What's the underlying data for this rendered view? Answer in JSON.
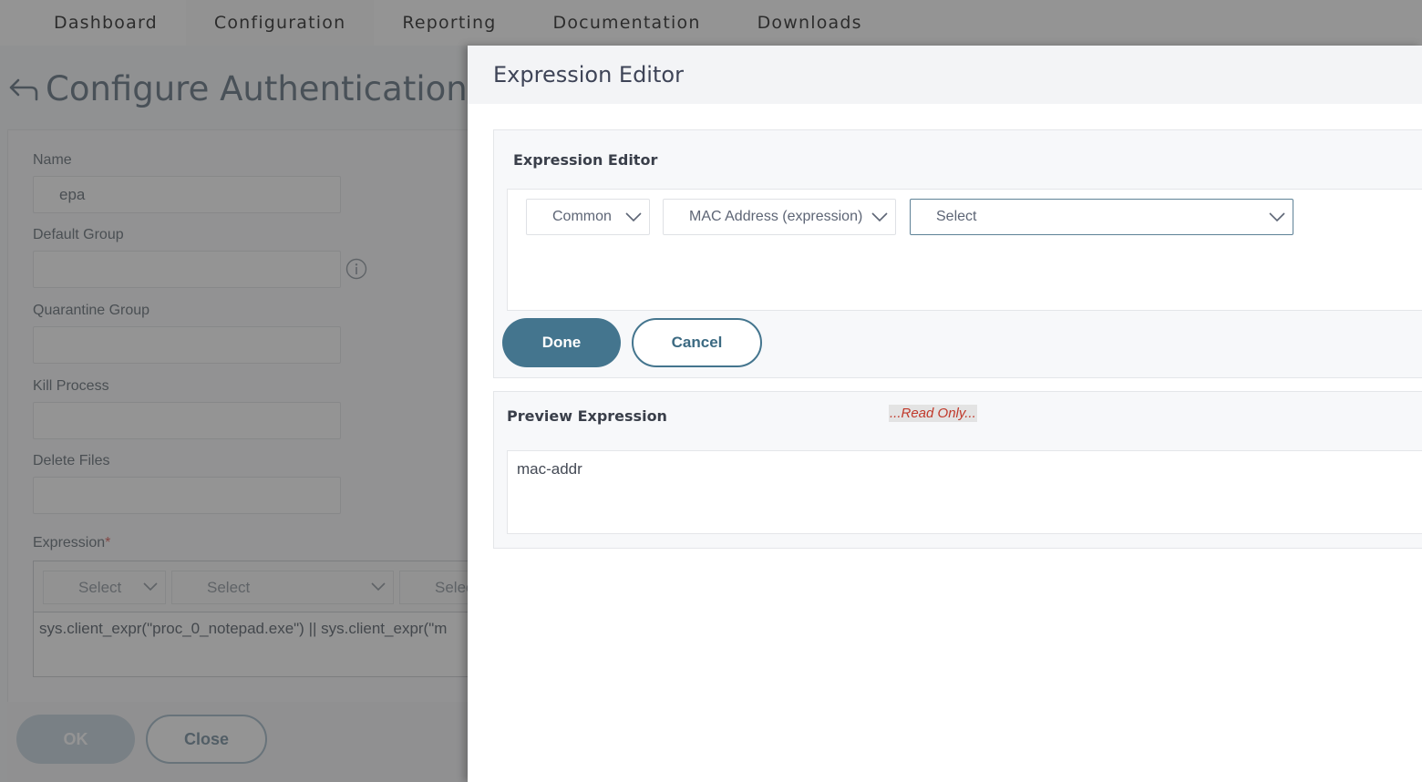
{
  "nav": {
    "tabs": [
      {
        "label": "Dashboard",
        "active": false
      },
      {
        "label": "Configuration",
        "active": true
      },
      {
        "label": "Reporting",
        "active": false
      },
      {
        "label": "Documentation",
        "active": false
      },
      {
        "label": "Downloads",
        "active": false
      }
    ]
  },
  "background_page": {
    "title": "Configure Authentication EPA Action",
    "fields": {
      "name": {
        "label": "Name",
        "value": "epa"
      },
      "default_group": {
        "label": "Default Group",
        "value": ""
      },
      "quarantine_group": {
        "label": "Quarantine Group",
        "value": ""
      },
      "kill_process": {
        "label": "Kill Process",
        "value": ""
      },
      "delete_files": {
        "label": "Delete Files",
        "value": ""
      }
    },
    "expression": {
      "label": "Expression",
      "required_marker": "*",
      "selects": [
        "Select",
        "Select",
        "Select"
      ],
      "value": "sys.client_expr(\"proc_0_notepad.exe\") || sys.client_expr(\"m"
    },
    "buttons": {
      "ok": "OK",
      "close": "Close"
    }
  },
  "drawer": {
    "title": "Expression Editor",
    "editor": {
      "section_title": "Expression Editor",
      "dropdowns": [
        {
          "value": "Common"
        },
        {
          "value": "MAC Address (expression)"
        },
        {
          "value": "Select"
        }
      ],
      "buttons": {
        "done": "Done",
        "cancel": "Cancel"
      }
    },
    "preview": {
      "section_title": "Preview Expression",
      "readonly_label": "...Read Only...",
      "value": "mac-addr"
    }
  },
  "colors": {
    "primary_button": "#44758e",
    "readonly_text": "#c0392b",
    "focused_border": "#5d8196"
  }
}
